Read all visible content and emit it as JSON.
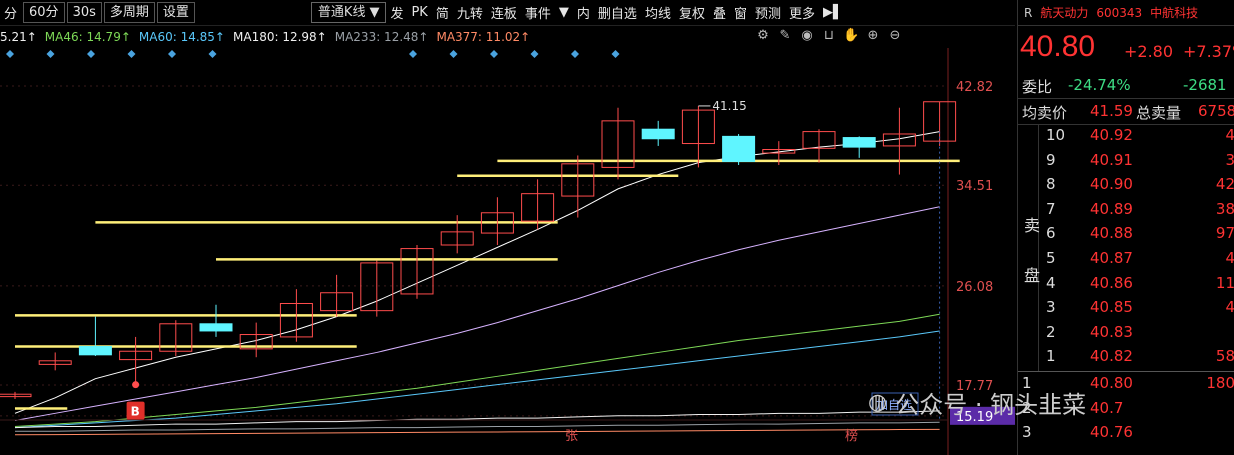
{
  "toolbar": {
    "left_items": [
      "分",
      "60分",
      "30s",
      "多周期",
      "设置"
    ],
    "chart_type": "普通K线",
    "buttons": [
      "发",
      "PK",
      "简",
      "九转",
      "连板",
      "事件",
      "内",
      "删自选",
      "均线",
      "复权",
      "叠",
      "窗",
      "预测",
      "更多"
    ]
  },
  "ma_labels": [
    {
      "text": "5.21↑",
      "color": "#f0f0f0"
    },
    {
      "text": "MA46: 14.79↑",
      "color": "#7ed957"
    },
    {
      "text": "MA60: 14.85↑",
      "color": "#5ac8fa"
    },
    {
      "text": "MA180: 12.98↑",
      "color": "#f0f0f0"
    },
    {
      "text": "MA233: 12.48↑",
      "color": "#9aa0a6"
    },
    {
      "text": "MA377: 11.02↑",
      "color": "#ff8a65"
    }
  ],
  "stock": {
    "flag": "R",
    "name": "航天动力",
    "code": "600343",
    "group": "中航科技",
    "price": "40.80",
    "change": "+2.80",
    "change_pct": "+7.37%",
    "weibi_label": "委比",
    "weibi": "-24.74%",
    "weicha": "-2681",
    "avg_sell_label": "均卖价",
    "avg_sell": "41.59",
    "total_sell_label": "总卖量",
    "total_sell": "6758",
    "sell_label_1": "卖",
    "sell_label_2": "盘"
  },
  "sell_book": [
    {
      "level": "10",
      "price": "40.92",
      "vol": "4"
    },
    {
      "level": "9",
      "price": "40.91",
      "vol": "3"
    },
    {
      "level": "8",
      "price": "40.90",
      "vol": "42"
    },
    {
      "level": "7",
      "price": "40.89",
      "vol": "38"
    },
    {
      "level": "6",
      "price": "40.88",
      "vol": "97"
    },
    {
      "level": "5",
      "price": "40.87",
      "vol": "4"
    },
    {
      "level": "4",
      "price": "40.86",
      "vol": "11"
    },
    {
      "level": "3",
      "price": "40.85",
      "vol": "4"
    },
    {
      "level": "2",
      "price": "40.83",
      "vol": ""
    },
    {
      "level": "1",
      "price": "40.82",
      "vol": "58"
    }
  ],
  "buy_book": [
    {
      "level": "1",
      "price": "40.80",
      "vol": "180"
    },
    {
      "level": "2",
      "price": "40.7",
      "vol": ""
    },
    {
      "level": "3",
      "price": "40.76",
      "vol": ""
    }
  ],
  "watermark": {
    "account": "公众号 · 钢头韭菜"
  },
  "chart_data": {
    "type": "candlestick",
    "y_ticks": [
      "42.82",
      "34.51",
      "26.08",
      "17.77",
      "15.19"
    ],
    "ylim": [
      13.5,
      45.5
    ],
    "peak_annotation": "41.15",
    "bottom_labels": [
      "张",
      "榜"
    ],
    "buy_marker": "B",
    "overlay_button": "加自选",
    "colors": {
      "up": "#ff4d4d",
      "down": "#5ff5ff",
      "support": "#ffef7a",
      "axis_hl": "#5b2ba8"
    },
    "candles": [
      {
        "o": 16.8,
        "h": 17.2,
        "l": 16.6,
        "c": 17.0
      },
      {
        "o": 19.5,
        "h": 20.5,
        "l": 19.0,
        "c": 19.8
      },
      {
        "o": 21.0,
        "h": 23.5,
        "l": 20.2,
        "c": 20.3
      },
      {
        "o": 19.9,
        "h": 21.8,
        "l": 17.8,
        "c": 20.6
      },
      {
        "o": 20.6,
        "h": 23.2,
        "l": 20.2,
        "c": 22.9
      },
      {
        "o": 22.9,
        "h": 24.5,
        "l": 21.8,
        "c": 22.3
      },
      {
        "o": 20.8,
        "h": 23.0,
        "l": 20.1,
        "c": 22.0
      },
      {
        "o": 21.8,
        "h": 25.8,
        "l": 21.4,
        "c": 24.6
      },
      {
        "o": 24.0,
        "h": 27.0,
        "l": 23.5,
        "c": 25.5
      },
      {
        "o": 24.0,
        "h": 28.2,
        "l": 23.5,
        "c": 28.0
      },
      {
        "o": 25.4,
        "h": 29.5,
        "l": 25.0,
        "c": 29.2
      },
      {
        "o": 29.5,
        "h": 32.0,
        "l": 28.8,
        "c": 30.6
      },
      {
        "o": 30.5,
        "h": 33.5,
        "l": 29.5,
        "c": 32.2
      },
      {
        "o": 31.5,
        "h": 35.0,
        "l": 30.8,
        "c": 33.8
      },
      {
        "o": 33.6,
        "h": 37.0,
        "l": 31.8,
        "c": 36.3
      },
      {
        "o": 36.0,
        "h": 41.0,
        "l": 35.0,
        "c": 39.9
      },
      {
        "o": 39.2,
        "h": 39.9,
        "l": 37.8,
        "c": 38.4
      },
      {
        "o": 38.0,
        "h": 41.15,
        "l": 36.0,
        "c": 40.8
      },
      {
        "o": 38.6,
        "h": 38.8,
        "l": 36.2,
        "c": 36.5
      },
      {
        "o": 37.2,
        "h": 38.2,
        "l": 36.2,
        "c": 37.5
      },
      {
        "o": 37.6,
        "h": 39.2,
        "l": 36.4,
        "c": 39.0
      },
      {
        "o": 38.5,
        "h": 38.6,
        "l": 36.8,
        "c": 37.7
      },
      {
        "o": 37.8,
        "h": 41.0,
        "l": 35.4,
        "c": 38.8
      },
      {
        "o": 38.2,
        "h": 41.5,
        "l": 37.8,
        "c": 41.5
      }
    ],
    "support_levels": [
      {
        "y": 36.55,
        "from": 12,
        "to": 23.5
      },
      {
        "y": 35.3,
        "from": 11,
        "to": 16.5
      },
      {
        "y": 31.4,
        "from": 2,
        "to": 13.5
      },
      {
        "y": 28.3,
        "from": 5,
        "to": 13.5
      },
      {
        "y": 23.6,
        "from": 0,
        "to": 8.5
      },
      {
        "y": 21.0,
        "from": 0,
        "to": 8.5
      },
      {
        "y": 15.8,
        "from": 0,
        "to": 1.3
      }
    ],
    "ma_lines": [
      {
        "color": "#ffffff",
        "values": [
          15.4,
          16.7,
          18.3,
          19.2,
          20.1,
          20.8,
          21.5,
          22.4,
          23.5,
          24.8,
          26.3,
          27.8,
          29.3,
          30.8,
          32.4,
          34.2,
          35.4,
          36.4,
          36.9,
          37.3,
          37.7,
          38.0,
          38.4,
          39.0
        ]
      },
      {
        "color": "#d7b3ff",
        "values": [
          14.8,
          15.4,
          16.0,
          16.6,
          17.2,
          17.8,
          18.4,
          19.1,
          19.8,
          20.5,
          21.3,
          22.1,
          23.0,
          24.0,
          25.0,
          26.1,
          27.2,
          28.2,
          29.1,
          29.9,
          30.6,
          31.3,
          32.0,
          32.7
        ]
      },
      {
        "color": "#7ed957",
        "values": [
          14.3,
          14.5,
          14.7,
          15.0,
          15.3,
          15.6,
          15.9,
          16.3,
          16.7,
          17.1,
          17.5,
          18.0,
          18.5,
          19.0,
          19.5,
          20.0,
          20.5,
          21.0,
          21.5,
          21.9,
          22.3,
          22.7,
          23.1,
          23.7
        ]
      },
      {
        "color": "#5ac8fa",
        "values": [
          14.2,
          14.4,
          14.6,
          14.8,
          15.0,
          15.3,
          15.6,
          15.9,
          16.2,
          16.6,
          17.0,
          17.4,
          17.8,
          18.2,
          18.6,
          19.0,
          19.4,
          19.8,
          20.2,
          20.6,
          21.0,
          21.4,
          21.8,
          22.3
        ]
      },
      {
        "color": "#f0f0f0",
        "values": [
          14.2,
          14.3,
          14.3,
          14.4,
          14.5,
          14.5,
          14.6,
          14.7,
          14.7,
          14.8,
          14.9,
          14.9,
          15.0,
          15.0,
          15.1,
          15.2,
          15.2,
          15.3,
          15.3,
          15.4,
          15.4,
          15.5,
          15.5,
          15.6
        ]
      },
      {
        "color": "#9aa0a6",
        "values": [
          13.9,
          13.9,
          13.95,
          14.0,
          14.0,
          14.05,
          14.1,
          14.1,
          14.15,
          14.2,
          14.2,
          14.25,
          14.3,
          14.3,
          14.35,
          14.4,
          14.4,
          14.45,
          14.5,
          14.5,
          14.55,
          14.6,
          14.6,
          14.65
        ]
      },
      {
        "color": "#ff8a65",
        "values": [
          13.6,
          13.62,
          13.64,
          13.66,
          13.68,
          13.7,
          13.72,
          13.74,
          13.76,
          13.78,
          13.8,
          13.82,
          13.84,
          13.86,
          13.88,
          13.9,
          13.92,
          13.94,
          13.96,
          13.98,
          14.0,
          14.02,
          14.04,
          14.06
        ]
      }
    ]
  }
}
